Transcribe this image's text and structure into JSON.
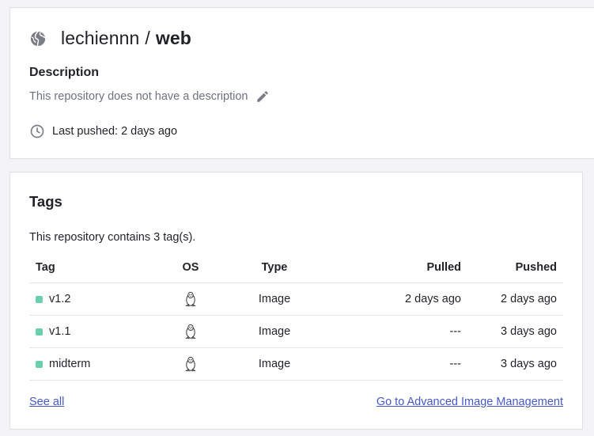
{
  "repository": {
    "owner": "lechiennn",
    "separator": "/",
    "name": "web",
    "description_heading": "Description",
    "description_placeholder": "This repository does not have a description",
    "last_pushed": "Last pushed: 2 days ago"
  },
  "tags": {
    "heading": "Tags",
    "count_text": "This repository contains 3 tag(s).",
    "columns": [
      "Tag",
      "OS",
      "Type",
      "Pulled",
      "Pushed"
    ],
    "rows": [
      {
        "tag": "v1.2",
        "os": "linux-icon",
        "type": "Image",
        "pulled": "2 days ago",
        "pushed": "2 days ago"
      },
      {
        "tag": "v1.1",
        "os": "linux-icon",
        "type": "Image",
        "pulled": "---",
        "pushed": "3 days ago"
      },
      {
        "tag": "midterm",
        "os": "linux-icon",
        "type": "Image",
        "pulled": "---",
        "pushed": "3 days ago"
      }
    ],
    "see_all_label": "See all",
    "advanced_label": "Go to Advanced Image Management"
  },
  "colors": {
    "link": "#4659c7",
    "tag_status": "#6ad0ac",
    "muted_text": "#6b7280"
  }
}
